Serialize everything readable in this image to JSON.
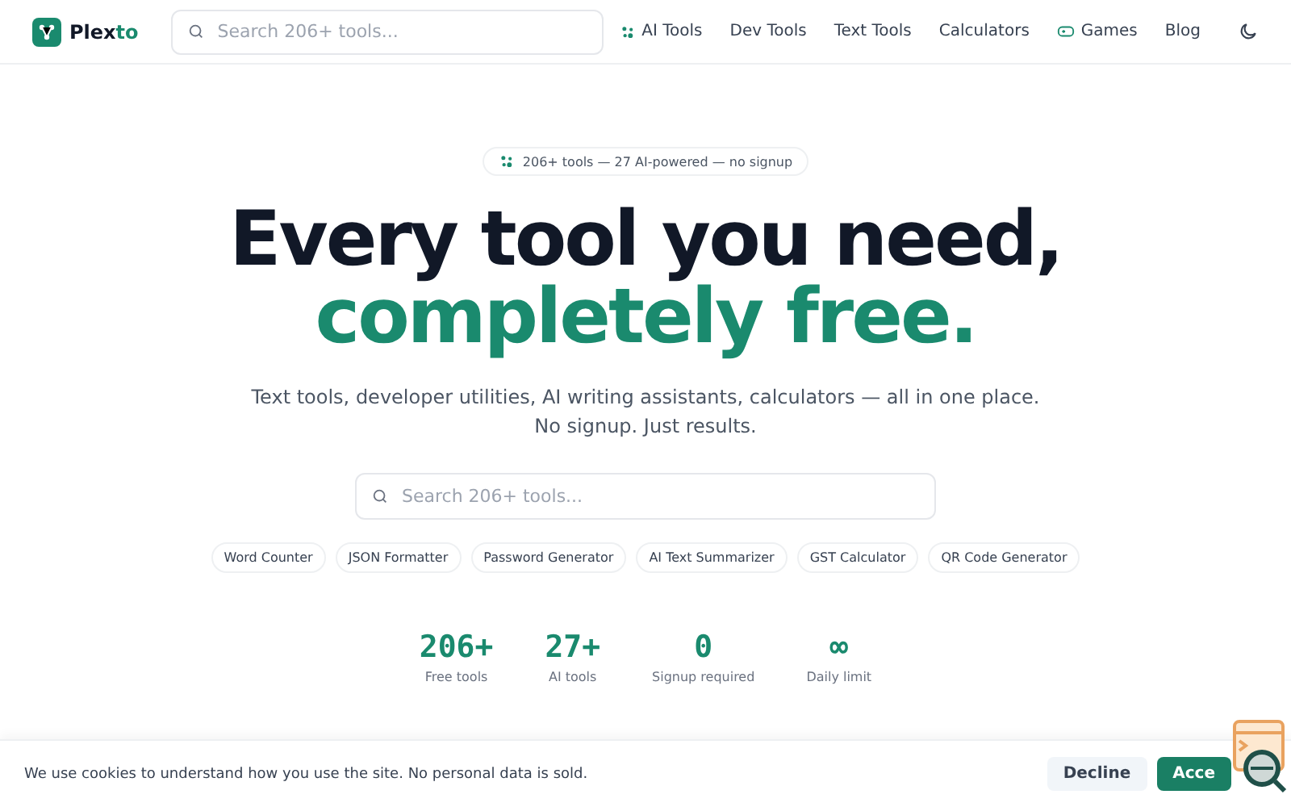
{
  "header": {
    "logo": "Plex",
    "logo_accent": "to",
    "search": {
      "placeholder": "Search 206+ tools..."
    },
    "nav": [
      {
        "label": "AI Tools",
        "kind": "ai"
      },
      {
        "label": "Dev Tools",
        "kind": "plain"
      },
      {
        "label": "Text Tools",
        "kind": "plain"
      },
      {
        "label": "Calculators",
        "kind": "plain"
      },
      {
        "label": "Games",
        "kind": "games"
      },
      {
        "label": "Blog",
        "kind": "plain"
      }
    ]
  },
  "hero": {
    "badge": "206+ tools — 27 AI-powered — no signup",
    "title_line_1": "Every tool you need,",
    "title_line_2": "completely free.",
    "subtitle_line_1": "Text tools, developer utilities, AI writing assistants, calculators — all in one place.",
    "subtitle_line_2": "No signup. Just results.",
    "search": {
      "placeholder": "Search 206+ tools..."
    },
    "chips": [
      "Word Counter",
      "JSON Formatter",
      "Password Generator",
      "AI Text Summarizer",
      "GST Calculator",
      "QR Code Generator"
    ],
    "stats": [
      {
        "value": "206+",
        "label": "Free tools"
      },
      {
        "value": "27+",
        "label": "AI tools"
      },
      {
        "value": "0",
        "label": "Signup required"
      },
      {
        "value": "∞",
        "label": "Daily limit"
      }
    ]
  },
  "cookie_bar": {
    "message": "We use cookies to understand how you use the site. No personal data is sold.",
    "buttons": [
      {
        "label": "Decline",
        "kind": "secondary"
      },
      {
        "label": "Acce",
        "kind": "primary"
      }
    ]
  }
}
